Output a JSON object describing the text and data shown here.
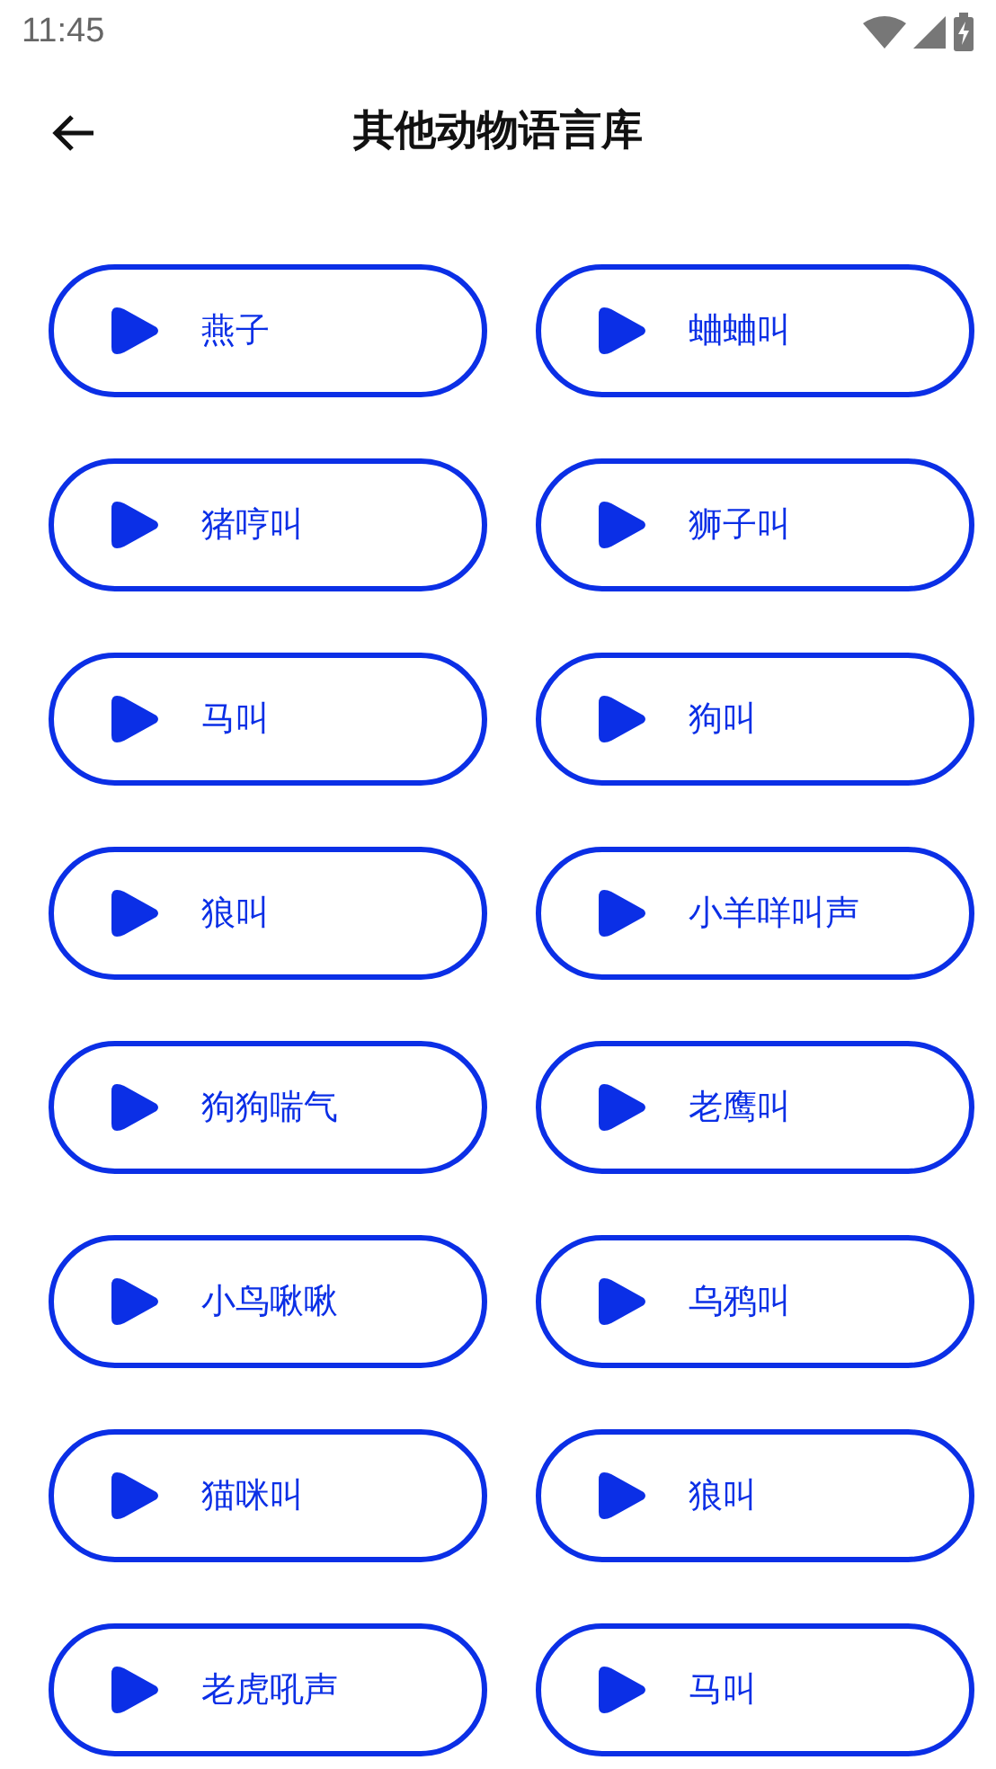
{
  "status_bar": {
    "time": "11:45"
  },
  "header": {
    "title": "其他动物语言库"
  },
  "sounds": [
    {
      "label": "燕子"
    },
    {
      "label": "蛐蛐叫"
    },
    {
      "label": "猪哼叫"
    },
    {
      "label": "狮子叫"
    },
    {
      "label": "马叫"
    },
    {
      "label": "狗叫"
    },
    {
      "label": "狼叫"
    },
    {
      "label": "小羊咩叫声"
    },
    {
      "label": "狗狗喘气"
    },
    {
      "label": "老鹰叫"
    },
    {
      "label": "小鸟啾啾"
    },
    {
      "label": "乌鸦叫"
    },
    {
      "label": "猫咪叫"
    },
    {
      "label": "狼叫"
    },
    {
      "label": "老虎吼声"
    },
    {
      "label": "马叫"
    }
  ]
}
